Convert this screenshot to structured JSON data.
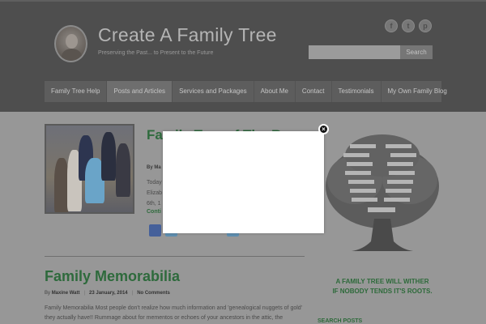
{
  "header": {
    "site_title": "Create A Family Tree",
    "tagline": "Preserving the Past... to Present to the Future",
    "search": {
      "placeholder": "",
      "button_label": "Search"
    },
    "social": [
      {
        "glyph": "f",
        "icon": "facebook-icon"
      },
      {
        "glyph": "t",
        "icon": "twitter-icon"
      },
      {
        "glyph": "p",
        "icon": "pinterest-icon"
      }
    ]
  },
  "nav": {
    "items": [
      {
        "label": "Family Tree Help"
      },
      {
        "label": "Posts and Articles",
        "active": true
      },
      {
        "label": "Services and Packages"
      },
      {
        "label": "About Me"
      },
      {
        "label": "Contact"
      },
      {
        "label": "Testimonials"
      },
      {
        "label": "My Own Family Blog"
      }
    ]
  },
  "post1": {
    "title_partial": "Family Tree of The Ro",
    "byline_partial": "By Ma",
    "excerpt_partial": "Today Elizab 6th, 1",
    "continue_partial": "Conti"
  },
  "post2": {
    "title": "Family Memorabilia",
    "author_prefix": "By",
    "author": "Maxine Watt",
    "date": "23 January, 2014",
    "comments": "No Comments",
    "excerpt": "Family Memorabilia Most people don't realize how much information and 'genealogical nuggets of gold' they actually have!! Rummage about for mementos or echoes of your ancestors in the attic, the"
  },
  "sidebar": {
    "quote_line1": "A FAMILY TREE WILL WITHER",
    "quote_line2": "IF NOBODY TENDS IT'S ROOTS.",
    "next_heading": "SEARCH POSTS"
  },
  "modal": {
    "close_glyph": "×"
  },
  "colors": {
    "header_bg": "#4e4e4e",
    "page_bg": "#979797",
    "accent_green": "#2f6b3d",
    "modal_bg": "#ffffff"
  }
}
